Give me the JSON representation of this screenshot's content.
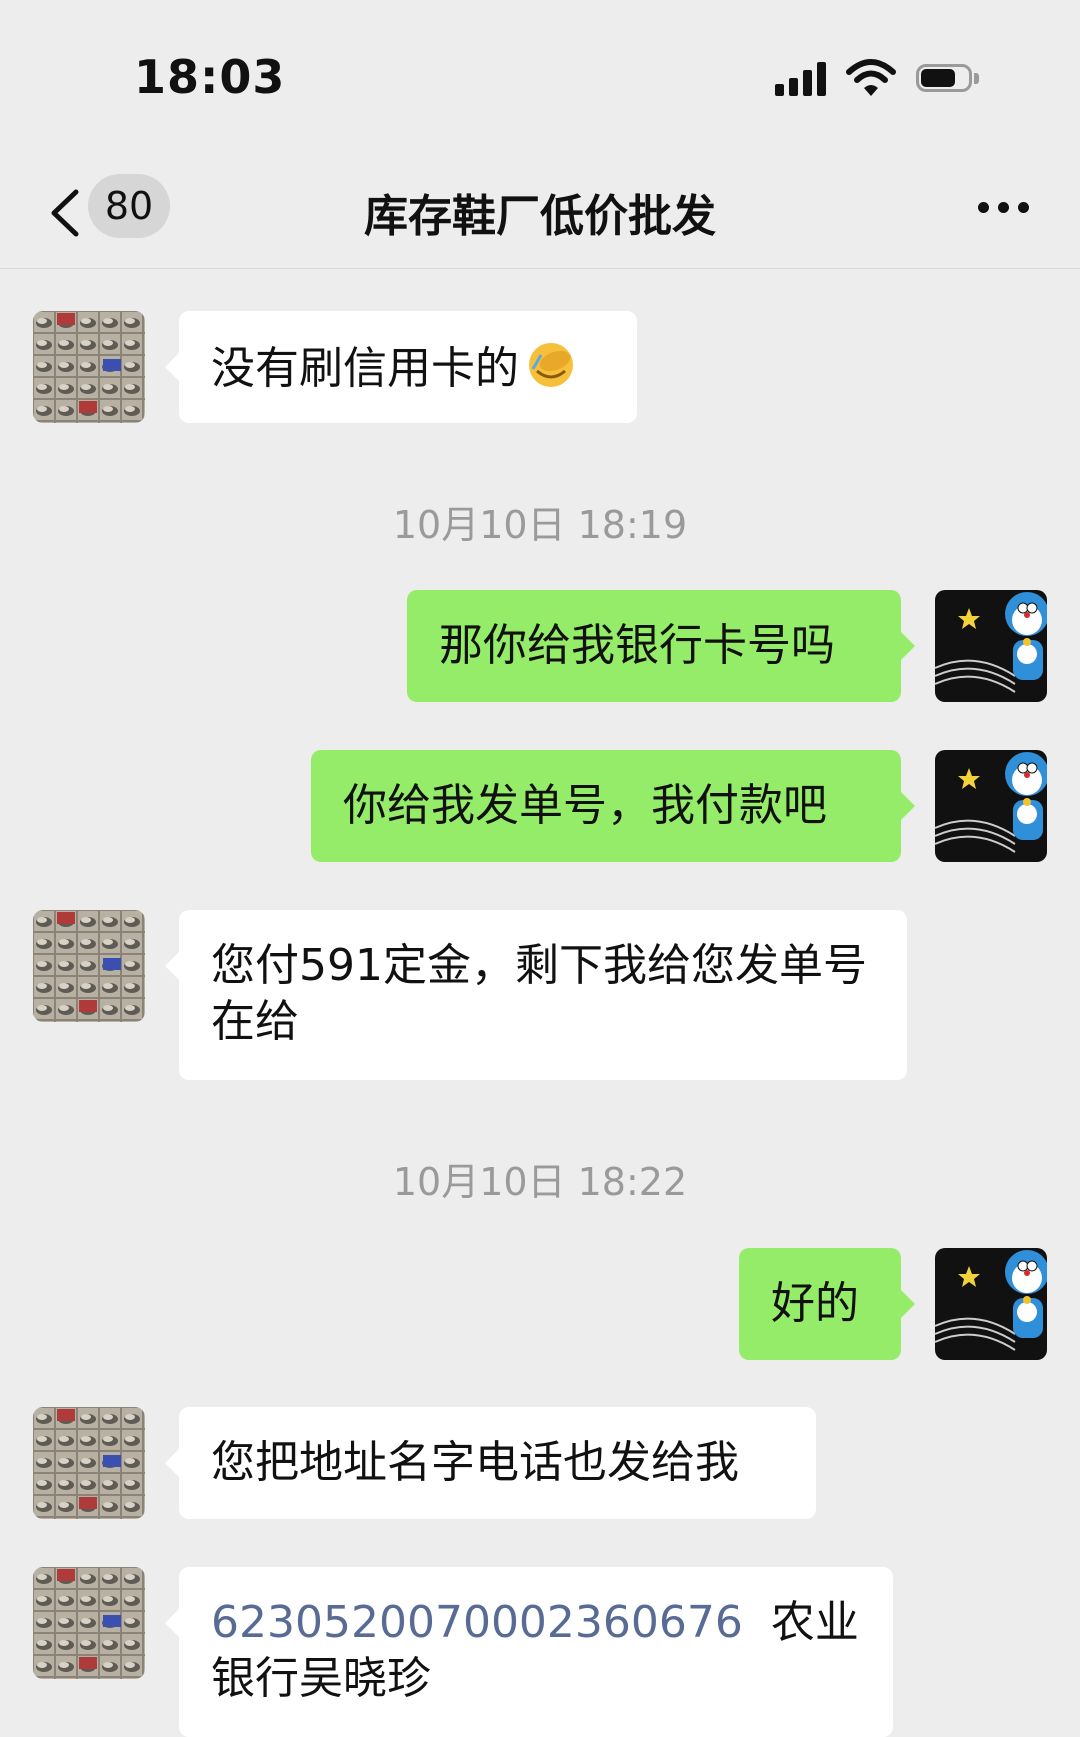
{
  "status_bar": {
    "time": "18:03"
  },
  "nav": {
    "unread_count": "80",
    "title": "库存鞋厂低价批发"
  },
  "messages": [
    {
      "side": "in",
      "text": "没有刷信用卡的"
    },
    {
      "timestamp": "10月10日 18:19"
    },
    {
      "side": "out",
      "text": "那你给我银行卡号吗"
    },
    {
      "side": "out",
      "text": "你给我发单号，我付款吧"
    },
    {
      "side": "in",
      "text": "您付591定金，剩下我给您发单号在给"
    },
    {
      "timestamp": "10月10日 18:22"
    },
    {
      "side": "out",
      "text": "好的"
    },
    {
      "side": "in",
      "text": "您把地址名字电话也发给我"
    },
    {
      "side": "in",
      "link": "6230520070002360676",
      "text": "农业银行吴晓珍"
    }
  ],
  "colors": {
    "background": "#ededed",
    "outgoing_bubble": "#95ec69",
    "incoming_bubble": "#ffffff",
    "link": "#576b95"
  }
}
